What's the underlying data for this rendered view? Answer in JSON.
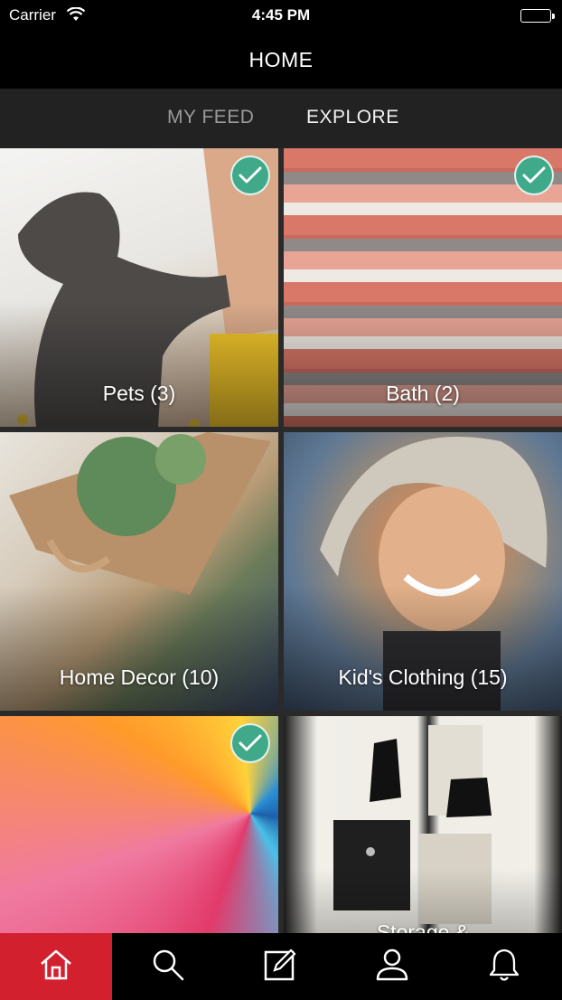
{
  "status_bar": {
    "carrier": "Carrier",
    "time": "4:45 PM"
  },
  "nav": {
    "title": "HOME"
  },
  "tabs": [
    {
      "label": "MY FEED",
      "selected": false
    },
    {
      "label": "EXPLORE",
      "selected": true
    }
  ],
  "categories": [
    {
      "label": "Pets (3)",
      "selected": true
    },
    {
      "label": "Bath (2)",
      "selected": true
    },
    {
      "label": "Home Decor (10)",
      "selected": false
    },
    {
      "label": "Kid's Clothing (15)",
      "selected": false
    },
    {
      "label": "",
      "selected": true
    },
    {
      "label": "Storage &",
      "selected": false
    }
  ],
  "bottom_nav": [
    {
      "icon": "home-icon",
      "active": true
    },
    {
      "icon": "search-icon",
      "active": false
    },
    {
      "icon": "compose-icon",
      "active": false
    },
    {
      "icon": "profile-icon",
      "active": false
    },
    {
      "icon": "bell-icon",
      "active": false
    }
  ],
  "colors": {
    "accent": "#d3202f",
    "check": "#3fa98a",
    "tab_bar": "#222222"
  }
}
